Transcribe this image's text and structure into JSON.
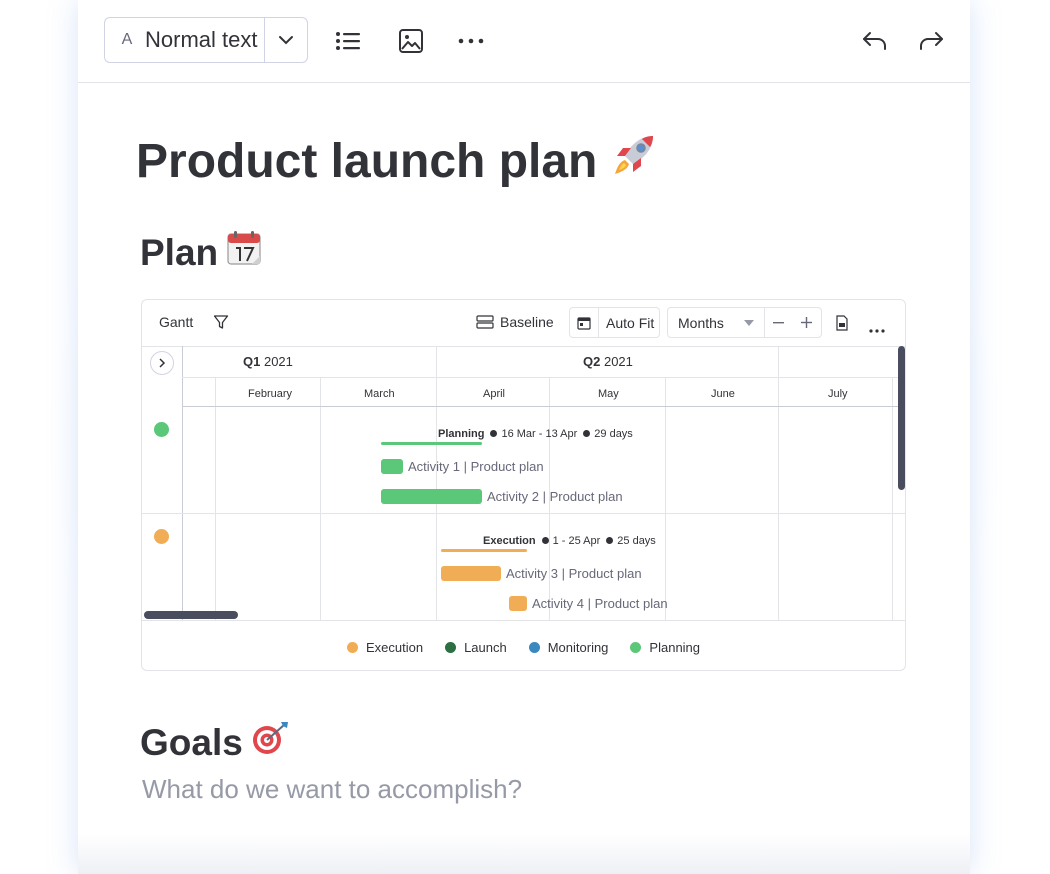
{
  "toolbar": {
    "style_prefix": "A",
    "style_value": "Normal text"
  },
  "doc": {
    "title": "Product launch plan",
    "title_emoji": "🚀",
    "plan_heading": "Plan",
    "plan_emoji": "📆",
    "goals_heading": "Goals",
    "goals_emoji": "🎯",
    "goals_placeholder": "What do we want to accomplish?"
  },
  "gantt": {
    "title": "Gantt",
    "baseline_label": "Baseline",
    "autofit_label": "Auto Fit",
    "scale_value": "Months",
    "quarters": [
      {
        "label_bold": "Q1",
        "label_rest": "2021"
      },
      {
        "label_bold": "Q2",
        "label_rest": "2021"
      }
    ],
    "months": [
      "February",
      "March",
      "April",
      "May",
      "June",
      "July"
    ],
    "groups": [
      {
        "name": "Planning",
        "dates": "16 Mar - 13 Apr",
        "duration": "29 days",
        "color": "#5bc778",
        "items": [
          "Activity 1 | Product plan",
          "Activity 2 | Product plan"
        ]
      },
      {
        "name": "Execution",
        "dates": "1 - 25 Apr",
        "duration": "25 days",
        "color": "#f0ad55",
        "items": [
          "Activity 3 | Product plan",
          "Activity 4 | Product plan"
        ]
      }
    ],
    "legend": [
      {
        "label": "Execution",
        "color": "#f0ad55"
      },
      {
        "label": "Launch",
        "color": "#2d6e43"
      },
      {
        "label": "Monitoring",
        "color": "#3a88c0"
      },
      {
        "label": "Planning",
        "color": "#5bc778"
      }
    ]
  },
  "colors": {
    "text": "#323338",
    "muted": "#676879",
    "placeholder": "#9699a6",
    "border": "#e3e4e8",
    "scrollbar": "#4a4d5e"
  }
}
